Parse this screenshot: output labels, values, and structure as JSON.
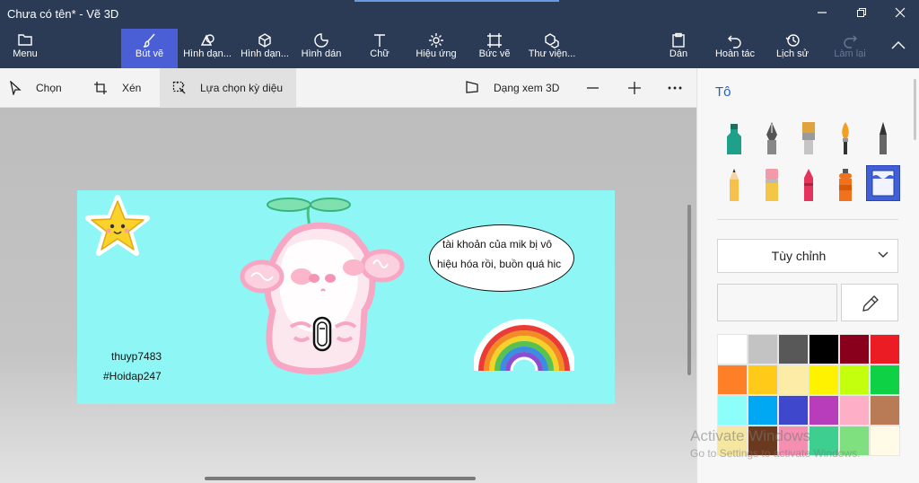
{
  "window": {
    "title": "Chưa có tên* - Vẽ 3D",
    "minimize_icon": "minimize-icon",
    "maximize_icon": "restore-icon",
    "close_icon": "close-icon"
  },
  "ribbon": {
    "menu_label": "Menu",
    "tools": [
      {
        "label": "Bút vẽ",
        "icon": "brush-icon",
        "active": true
      },
      {
        "label": "Hình dạn...",
        "icon": "2d-shapes-icon"
      },
      {
        "label": "Hình dạn...",
        "icon": "3d-shapes-icon"
      },
      {
        "label": "Hình dán",
        "icon": "stickers-icon"
      },
      {
        "label": "Chữ",
        "icon": "text-icon"
      },
      {
        "label": "Hiệu ứng",
        "icon": "effects-icon"
      },
      {
        "label": "Bức vẽ",
        "icon": "canvas-icon"
      },
      {
        "label": "Thư viện...",
        "icon": "library-icon"
      }
    ],
    "paste_label": "Dán",
    "undo_label": "Hoàn tác",
    "history_label": "Lịch sử",
    "redo_label": "Làm lại",
    "accent": "#4a5fd6",
    "background": "#2b3a55"
  },
  "toolbar": {
    "select_label": "Chọn",
    "crop_label": "Xén",
    "magic_select_label": "Lựa chọn kỳ diệu",
    "view3d_label": "Dạng xem 3D"
  },
  "canvas": {
    "background": "#8ef7f6",
    "speech_line1": "tài khoản của mik bị vô",
    "speech_line2": "hiệu hóa rồi, buồn quá hic",
    "signature_line1": "thuyp7483",
    "signature_line2": "#Hoidap247"
  },
  "panel": {
    "title": "Tô",
    "dropdown_value": "Tùy chỉnh",
    "swatches": [
      "#ffffff",
      "#c3c3c3",
      "#585858",
      "#000000",
      "#88001b",
      "#ec1c24",
      "#ff7f27",
      "#ffca18",
      "#fdeca6",
      "#fff200",
      "#c4ff0e",
      "#0ed145",
      "#8cfffb",
      "#00a8f3",
      "#3f48cc",
      "#b83dba",
      "#ffaec8",
      "#b97a56",
      "#f5e7a0",
      "#6b3a1e",
      "#f48fb1",
      "#3ccf8f",
      "#7fe07f",
      "#fffbe6"
    ]
  },
  "watermark": {
    "line1": "Activate Windows",
    "line2": "Go to Settings to activate Windows."
  }
}
